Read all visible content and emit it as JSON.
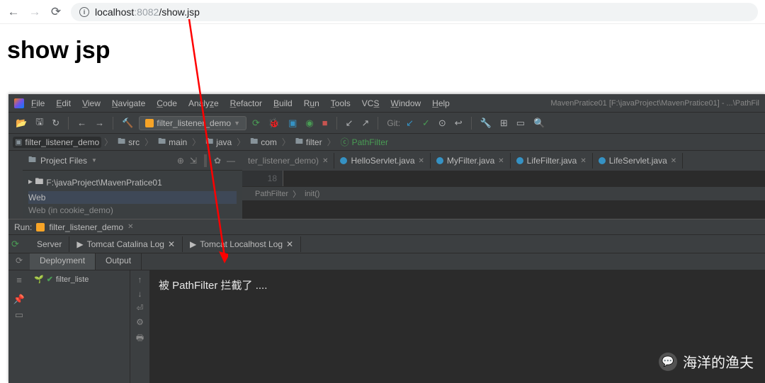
{
  "browser": {
    "url_host": "localhost",
    "url_port": ":8082",
    "url_path": "/show.jsp"
  },
  "page": {
    "heading": "show jsp"
  },
  "ide": {
    "title": "MavenPratice01 [F:\\javaProject\\MavenPratice01] - ...\\PathFil",
    "menu": [
      "File",
      "Edit",
      "View",
      "Navigate",
      "Code",
      "Analyze",
      "Refactor",
      "Build",
      "Run",
      "Tools",
      "VCS",
      "Window",
      "Help"
    ],
    "run_config": "filter_listener_demo",
    "git_label": "Git:",
    "breadcrumb": [
      "filter_listener_demo",
      "src",
      "main",
      "java",
      "com",
      "filter",
      "PathFilter"
    ],
    "project_panel_label": "Project Files",
    "project_row1": "F:\\javaProject\\MavenPratice01",
    "project_row2": "Web",
    "project_row3": "Web (in cookie_demo)",
    "editor_tabs": [
      "ter_listener_demo)",
      "HelloServlet.java",
      "MyFilter.java",
      "LifeFilter.java",
      "LifeServlet.java"
    ],
    "line_no": "18",
    "code_breadcrumb": [
      "PathFilter",
      "init()"
    ],
    "run_label": "Run:",
    "run_config_tab": "filter_listener_demo",
    "run_tabs": [
      "Server",
      "Tomcat Catalina Log",
      "Tomcat Localhost Log"
    ],
    "run_subtabs": [
      "Deployment",
      "Output"
    ],
    "deploy_item": "filter_liste",
    "console_output": "被 PathFilter 拦截了 ...."
  },
  "watermark": "海洋的渔夫"
}
